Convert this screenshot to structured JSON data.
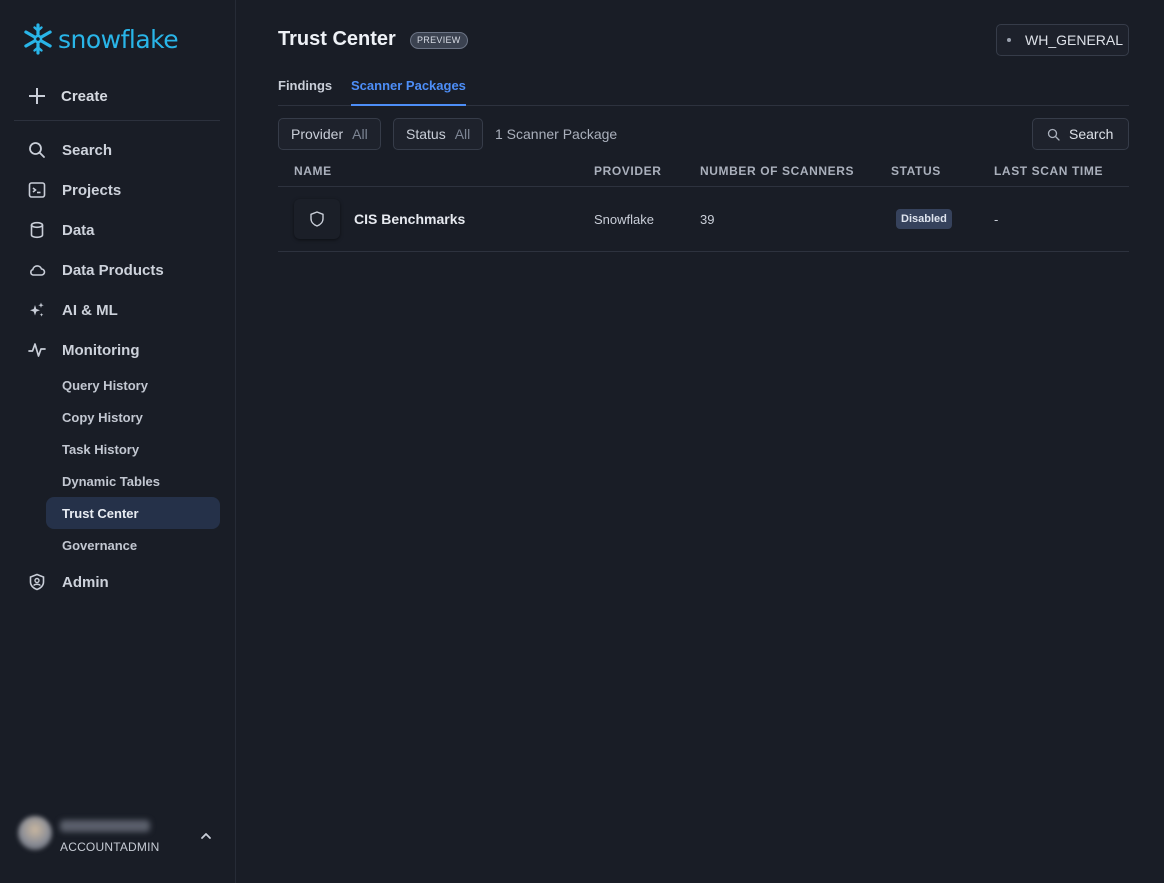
{
  "brand": {
    "name": "snowflake",
    "color": "#29b5e8"
  },
  "sidebar": {
    "create_label": "Create",
    "items": [
      {
        "label": "Search",
        "icon": "search-icon"
      },
      {
        "label": "Projects",
        "icon": "terminal-icon"
      },
      {
        "label": "Data",
        "icon": "database-icon"
      },
      {
        "label": "Data Products",
        "icon": "cloud-icon"
      },
      {
        "label": "AI & ML",
        "icon": "sparkle-icon"
      },
      {
        "label": "Monitoring",
        "icon": "activity-icon"
      }
    ],
    "monitoring_sub": [
      {
        "label": "Query History"
      },
      {
        "label": "Copy History"
      },
      {
        "label": "Task History"
      },
      {
        "label": "Dynamic Tables"
      },
      {
        "label": "Trust Center",
        "active": true
      },
      {
        "label": "Governance"
      }
    ],
    "admin_label": "Admin",
    "user": {
      "role": "ACCOUNTADMIN"
    }
  },
  "header": {
    "title": "Trust Center",
    "badge": "PREVIEW",
    "warehouse": "WH_GENERAL"
  },
  "tabs": [
    {
      "label": "Findings",
      "active": false
    },
    {
      "label": "Scanner Packages",
      "active": true
    }
  ],
  "filters": {
    "provider": {
      "label": "Provider",
      "value": "All"
    },
    "status": {
      "label": "Status",
      "value": "All"
    },
    "count_text": "1 Scanner Package",
    "search_label": "Search"
  },
  "table": {
    "columns": [
      "NAME",
      "PROVIDER",
      "NUMBER OF SCANNERS",
      "STATUS",
      "LAST SCAN TIME"
    ],
    "rows": [
      {
        "name": "CIS Benchmarks",
        "provider": "Snowflake",
        "scanners": "39",
        "status": "Disabled",
        "last_scan": "-"
      }
    ]
  },
  "colors": {
    "accent": "#4d8ef7",
    "background": "#191d26",
    "active_nav": "#253149"
  }
}
